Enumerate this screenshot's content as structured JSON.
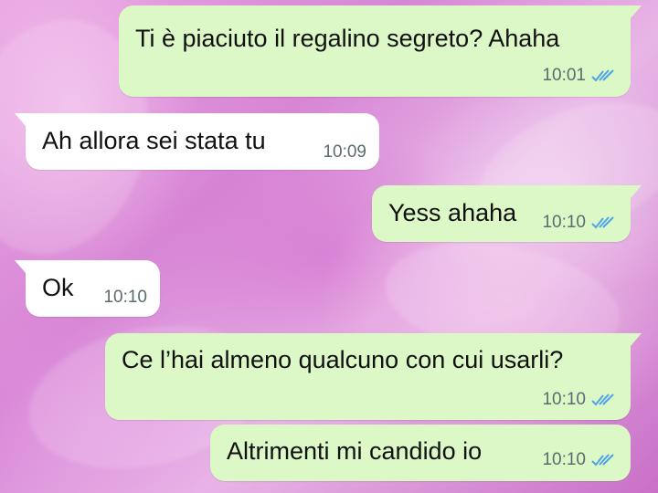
{
  "messages": [
    {
      "direction": "outgoing",
      "text": "Ti è piaciuto il regalino segreto? Ahaha",
      "time": "10:01",
      "status_icon": "double-check-read-icon"
    },
    {
      "direction": "incoming",
      "text": "Ah allora sei stata tu",
      "time": "10:09"
    },
    {
      "direction": "outgoing",
      "text": "Yess ahaha",
      "time": "10:10",
      "status_icon": "double-check-read-icon"
    },
    {
      "direction": "incoming",
      "text": "Ok",
      "time": "10:10"
    },
    {
      "direction": "outgoing",
      "text": "Ce l’hai almeno qualcuno con cui usarli?",
      "time": "10:10",
      "status_icon": "double-check-read-icon"
    },
    {
      "direction": "outgoing",
      "text": "Altrimenti mi candido io",
      "time": "10:10",
      "status_icon": "double-check-read-icon"
    }
  ],
  "colors": {
    "outgoing_bubble": "#dcf8c6",
    "incoming_bubble": "#ffffff",
    "read_tick": "#4fa3e8",
    "timestamp": "#5b6b70"
  }
}
